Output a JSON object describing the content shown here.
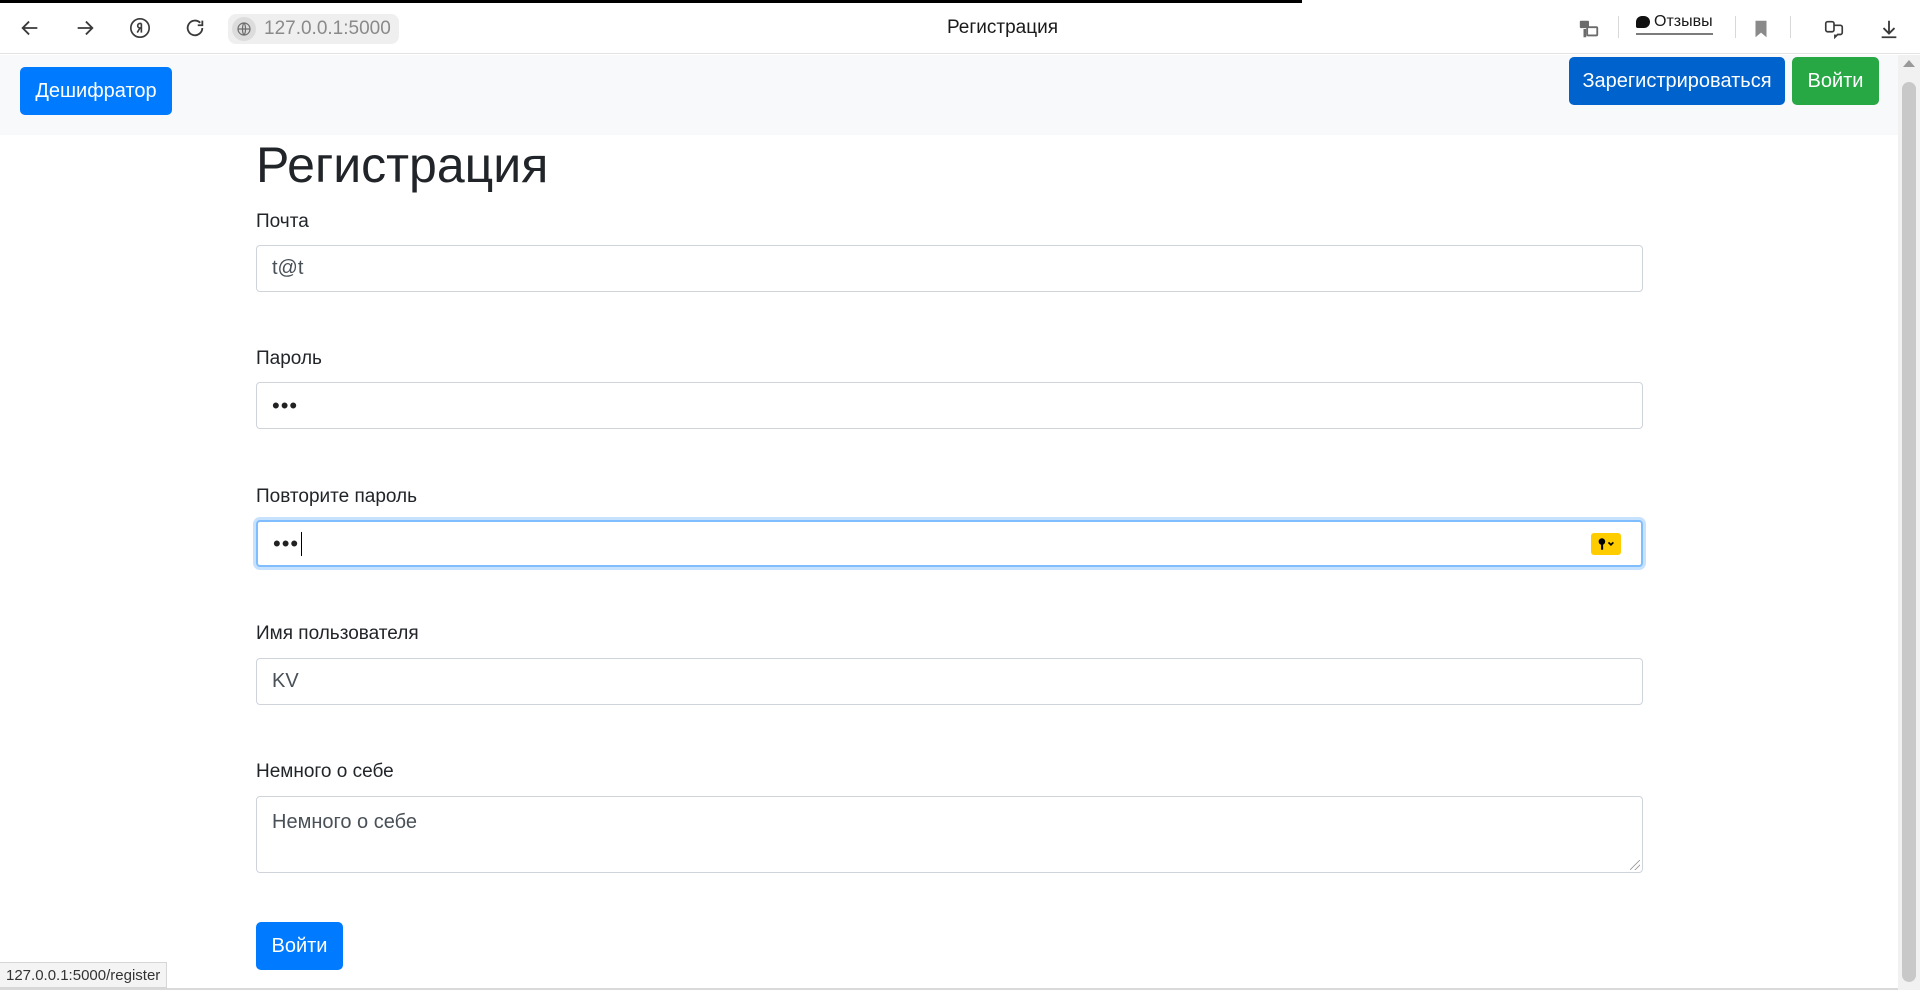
{
  "browser": {
    "url": "127.0.0.1:5000",
    "tab_title": "Регистрация",
    "reviews_label": "Отзывы",
    "status_url": "127.0.0.1:5000/register",
    "icons": {
      "back": "arrow-left-icon",
      "forward": "arrow-right-icon",
      "yandex": "yandex-icon",
      "reload": "reload-icon",
      "site_info": "globe-icon",
      "translate": "translate-icon",
      "bookmark": "bookmark-icon",
      "collections": "collections-icon",
      "downloads": "download-icon"
    }
  },
  "navbar": {
    "brand_label": "Дешифратор",
    "register_label": "Зарегистрироваться",
    "login_label": "Войти"
  },
  "form": {
    "heading": "Регистрация",
    "email": {
      "label": "Почта",
      "value": "t@t"
    },
    "password": {
      "label": "Пароль",
      "value": "•••"
    },
    "password_repeat": {
      "label": "Повторите пароль",
      "value": "•••"
    },
    "username": {
      "label": "Имя пользователя",
      "value": "KV"
    },
    "about": {
      "label": "Немного о себе",
      "placeholder": "Немного о себе"
    },
    "submit_label": "Войти"
  },
  "colors": {
    "primary": "#007bff",
    "primary_dark": "#0062cc",
    "success": "#28a745",
    "focus_border": "#80bdff",
    "password_manager_badge": "#ffcc00"
  }
}
